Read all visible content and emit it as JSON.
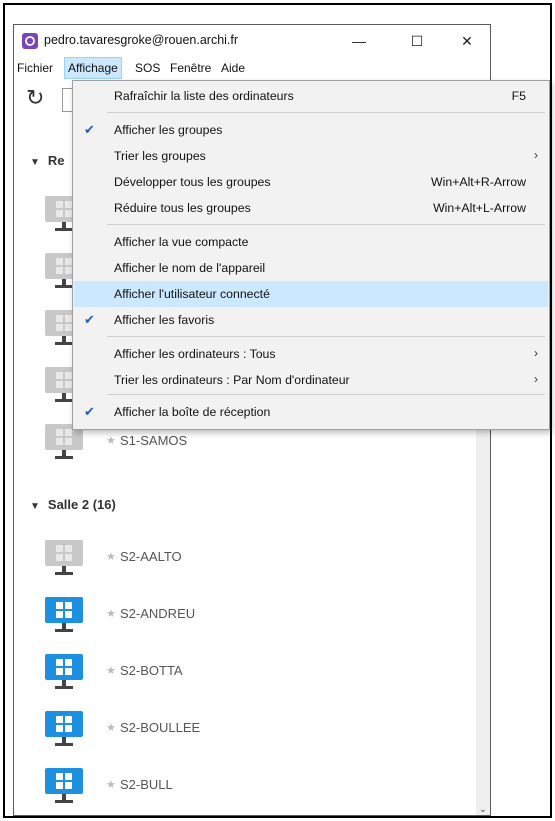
{
  "window": {
    "title": "pedro.tavaresgroke@rouen.archi.fr",
    "minimize": "—",
    "maximize": "☐",
    "close": "✕"
  },
  "menubar": [
    "Fichier",
    "Affichage",
    "SOS",
    "Fenêtre",
    "Aide"
  ],
  "dropdown": [
    {
      "label": "Rafraîchir la liste des ordinateurs",
      "shortcut": "F5",
      "checked": false,
      "submenu": false
    },
    {
      "label": "Afficher les groupes",
      "shortcut": "",
      "checked": true,
      "submenu": false
    },
    {
      "label": "Trier les groupes",
      "shortcut": "",
      "checked": false,
      "submenu": true
    },
    {
      "label": "Développer tous les groupes",
      "shortcut": "Win+Alt+R-Arrow",
      "checked": false,
      "submenu": false
    },
    {
      "label": "Réduire tous les groupes",
      "shortcut": "Win+Alt+L-Arrow",
      "checked": false,
      "submenu": false
    },
    {
      "label": "Afficher la vue compacte",
      "shortcut": "",
      "checked": false,
      "submenu": false
    },
    {
      "label": "Afficher le nom de l'appareil",
      "shortcut": "",
      "checked": false,
      "submenu": false
    },
    {
      "label": "Afficher l'utilisateur connecté",
      "shortcut": "",
      "checked": false,
      "submenu": false,
      "highlighted": true
    },
    {
      "label": "Afficher les favoris",
      "shortcut": "",
      "checked": true,
      "submenu": false
    },
    {
      "label": "Afficher les ordinateurs : Tous",
      "shortcut": "",
      "checked": false,
      "submenu": true
    },
    {
      "label": "Trier les ordinateurs : Par Nom d'ordinateur",
      "shortcut": "",
      "checked": false,
      "submenu": true
    },
    {
      "label": "Afficher la boîte de réception",
      "shortcut": "",
      "checked": true,
      "submenu": false
    }
  ],
  "groups": [
    {
      "name": "Re",
      "computers": [
        {
          "name": "",
          "online": false
        },
        {
          "name": "",
          "online": false
        },
        {
          "name": "",
          "online": false
        },
        {
          "name": "",
          "online": false
        },
        {
          "name": "S1-SAMOS",
          "online": false
        }
      ]
    },
    {
      "name": "Salle 2 (16)",
      "computers": [
        {
          "name": "S2-AALTO",
          "online": false
        },
        {
          "name": "S2-ANDREU",
          "online": true
        },
        {
          "name": "S2-BOTTA",
          "online": true
        },
        {
          "name": "S2-BOULLEE",
          "online": true
        },
        {
          "name": "S2-BULL",
          "online": true
        }
      ]
    }
  ],
  "glyphs": {
    "check": "✔",
    "arrow": "›",
    "star": "★",
    "triangle": "▼",
    "refresh": "↻",
    "scroll_down": "⌄"
  },
  "colors": {
    "online": "#1e90e0",
    "offline": "#c8c8c8",
    "highlight": "#cce8ff",
    "app_icon": "#7a45b8"
  }
}
